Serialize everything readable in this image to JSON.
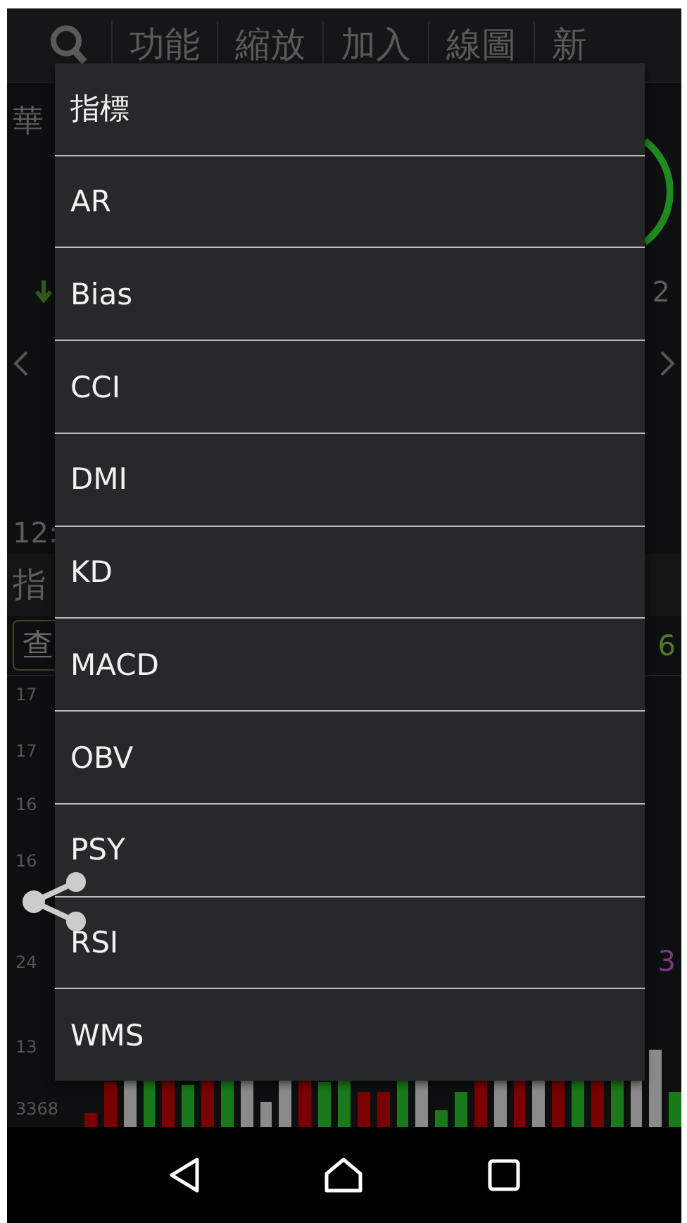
{
  "toolbar": {
    "tabs": [
      {
        "label": "功能"
      },
      {
        "label": "縮放"
      },
      {
        "label": "加入"
      },
      {
        "label": "線圖"
      },
      {
        "label": "新"
      }
    ]
  },
  "quote": {
    "name": "華",
    "change": "2",
    "time": "12:",
    "indicator_button": "指",
    "query_button": "查",
    "value": "6"
  },
  "chart": {
    "y_labels": [
      "17",
      "17",
      "16",
      "16",
      "24",
      "13"
    ],
    "volume_label": "3368",
    "indicator_value": "3"
  },
  "menu": {
    "title": "指標",
    "items": [
      "AR",
      "Bias",
      "CCI",
      "DMI",
      "KD",
      "MACD",
      "OBV",
      "PSY",
      "RSI",
      "WMS"
    ]
  }
}
